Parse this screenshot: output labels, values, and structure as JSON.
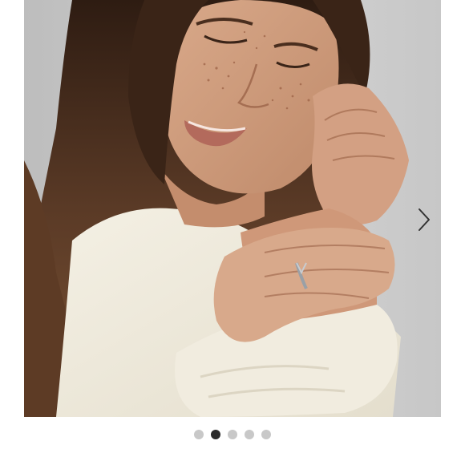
{
  "carousel": {
    "slide_count": 5,
    "active_index": 1,
    "colors": {
      "backdrop": "#cbcbcb",
      "hair": "#4a3122",
      "skin": "#cf9a7c",
      "sweater": "#f0ebdd",
      "arrow": "#333333",
      "dot_active": "#2a2a2a",
      "dot_inactive": "#c8c8c8"
    },
    "icons": {
      "next": "chevron-right-icon"
    }
  }
}
